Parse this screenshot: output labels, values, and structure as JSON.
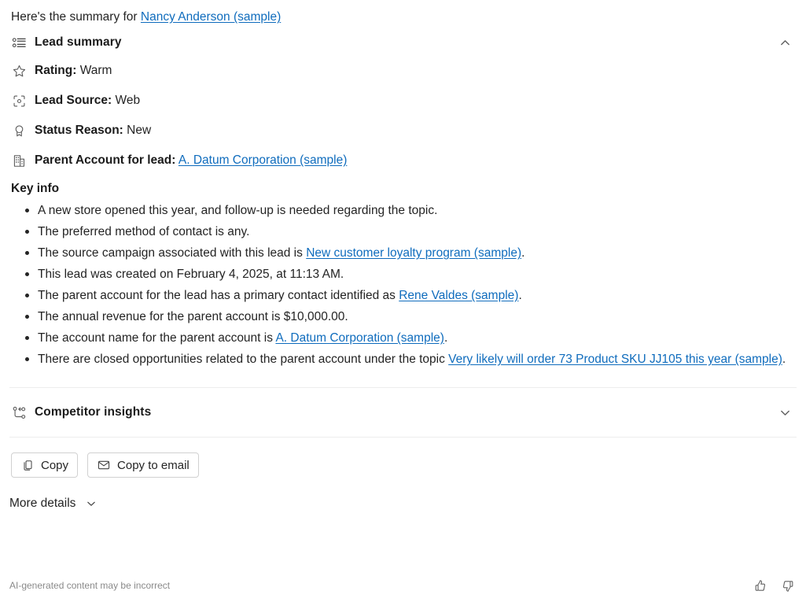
{
  "intro": {
    "prefix": "Here's the summary for ",
    "link_text": "Nancy Anderson (sample)"
  },
  "lead_summary": {
    "icon": "bulleted-list-icon",
    "title": "Lead summary",
    "collapse_icon": "chevron-up-icon",
    "attributes": [
      {
        "icon": "star-icon",
        "label": "Rating:",
        "value": "Warm"
      },
      {
        "icon": "scan-target-icon",
        "label": "Lead Source:",
        "value": "Web"
      },
      {
        "icon": "ribbon-badge-icon",
        "label": "Status Reason:",
        "value": "New"
      },
      {
        "icon": "building-icon",
        "label": "Parent Account for lead:",
        "value": "A. Datum Corporation (sample)",
        "value_is_link": true
      }
    ],
    "key_info": {
      "title": "Key info",
      "bullets": [
        {
          "parts": [
            {
              "t": "A new store opened this year, and follow-up is needed regarding the topic."
            }
          ]
        },
        {
          "parts": [
            {
              "t": "The preferred method of contact is any."
            }
          ]
        },
        {
          "parts": [
            {
              "t": "The source campaign associated with this lead is "
            },
            {
              "t": "New customer loyalty program (sample)",
              "link": true
            },
            {
              "t": "."
            }
          ]
        },
        {
          "parts": [
            {
              "t": "This lead was created on February 4, 2025, at 11:13 AM."
            }
          ]
        },
        {
          "parts": [
            {
              "t": "The parent account for the lead has a primary contact identified as "
            },
            {
              "t": "Rene Valdes (sample)",
              "link": true
            },
            {
              "t": "."
            }
          ]
        },
        {
          "parts": [
            {
              "t": "The annual revenue for the parent account is $10,000.00."
            }
          ]
        },
        {
          "parts": [
            {
              "t": "The account name for the parent account is "
            },
            {
              "t": "A. Datum Corporation (sample)",
              "link": true
            },
            {
              "t": "."
            }
          ]
        },
        {
          "parts": [
            {
              "t": "There are closed opportunities related to the parent account under the topic "
            },
            {
              "t": "Very likely will order 73 Product SKU JJ105 this year (sample)",
              "link": true
            },
            {
              "t": "."
            }
          ]
        }
      ]
    }
  },
  "competitor_insights": {
    "icon": "branch-compare-icon",
    "title": "Competitor insights",
    "expand_icon": "chevron-down-icon"
  },
  "actions": {
    "copy": {
      "icon": "copy-icon",
      "label": "Copy"
    },
    "copy_to_email": {
      "icon": "mail-icon",
      "label": "Copy to email"
    }
  },
  "more_details": {
    "label": "More details",
    "icon": "chevron-down-icon"
  },
  "footer": {
    "disclaimer": "AI-generated content may be incorrect",
    "thumbs_up": "thumbs-up-icon",
    "thumbs_down": "thumbs-down-icon"
  },
  "colors": {
    "link": "#0f6cbd",
    "text": "#242424",
    "muted": "#8a8a8a",
    "divider": "#ededed",
    "border": "#d1d1d1"
  }
}
